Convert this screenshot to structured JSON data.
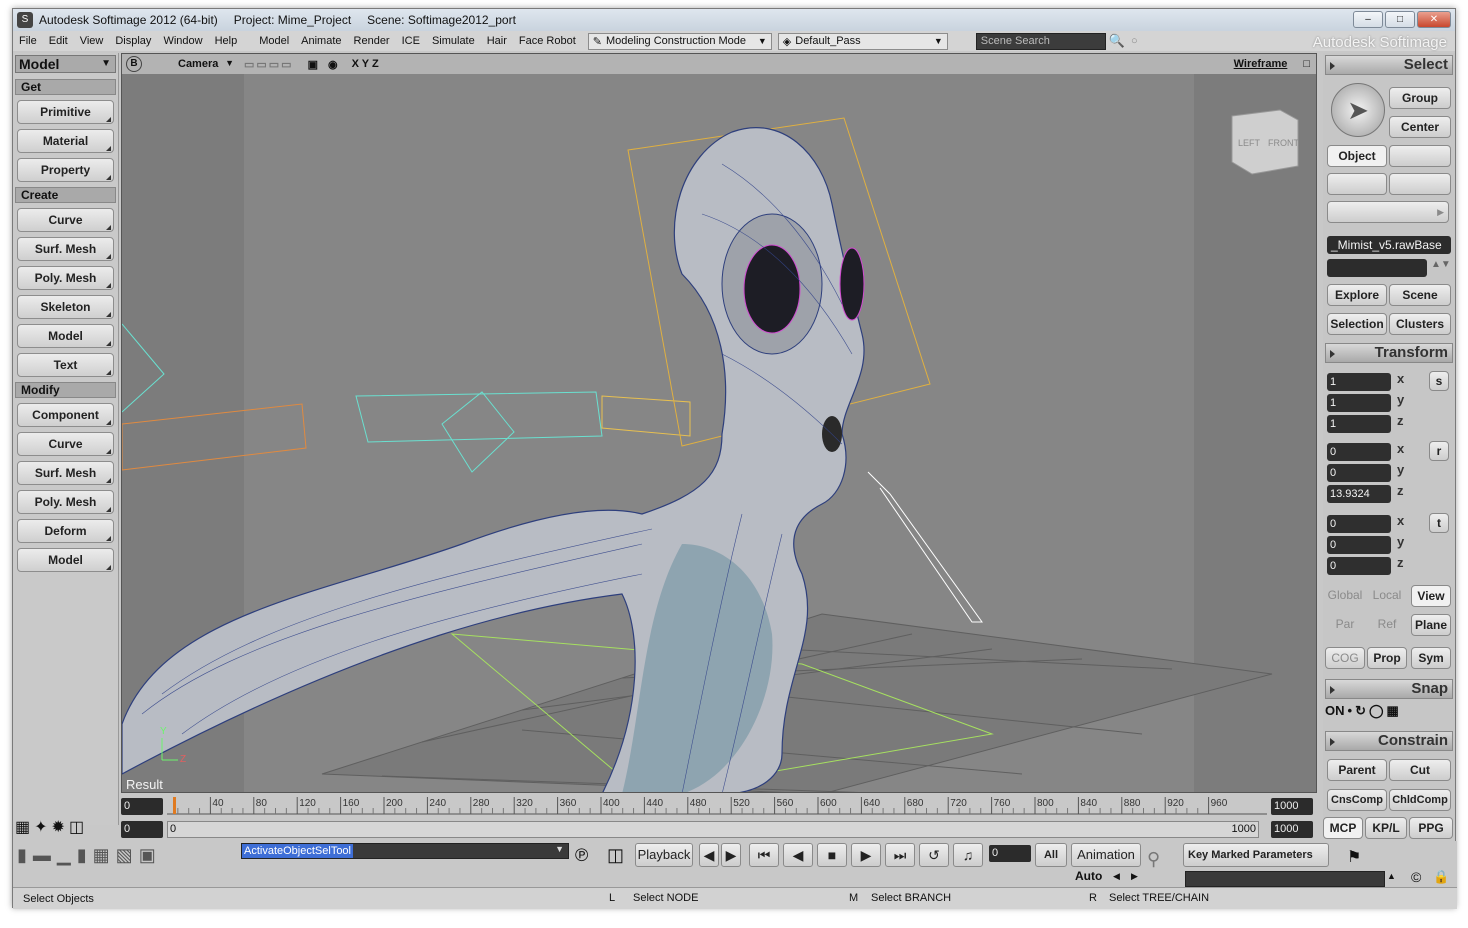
{
  "window": {
    "title": "Autodesk Softimage 2012 (64-bit)",
    "project": "Project: Mime_Project",
    "scene": "Scene: Softimage2012_port",
    "brand": "Autodesk Softimage"
  },
  "menu": [
    "File",
    "Edit",
    "View",
    "Display",
    "Window",
    "Help",
    "Model",
    "Animate",
    "Render",
    "ICE",
    "Simulate",
    "Hair",
    "Face Robot"
  ],
  "construction_mode": "Modeling Construction Mode",
  "render_pass": "Default_Pass",
  "search_placeholder": "Scene Search",
  "left_panel": {
    "module": "Model",
    "sections": [
      {
        "title": "Get",
        "buttons": [
          "Primitive",
          "Material",
          "Property"
        ]
      },
      {
        "title": "Create",
        "buttons": [
          "Curve",
          "Surf. Mesh",
          "Poly. Mesh",
          "Skeleton",
          "Model",
          "Text"
        ]
      },
      {
        "title": "Modify",
        "buttons": [
          "Component",
          "Curve",
          "Surf. Mesh",
          "Poly. Mesh",
          "Deform",
          "Model"
        ]
      }
    ]
  },
  "viewport": {
    "camera": "Camera",
    "axes": "X Y Z",
    "shading": "Wireframe",
    "label": "Result",
    "cube_left": "LEFT",
    "cube_front": "FRONT",
    "axis_y": "Y",
    "axis_z": "Z"
  },
  "right_panel": {
    "select_title": "Select",
    "group": "Group",
    "center": "Center",
    "object": "Object",
    "selection_name": "_Mimist_v5.rawBase",
    "explore": "Explore",
    "scene": "Scene",
    "selection": "Selection",
    "clusters": "Clusters",
    "transform_title": "Transform",
    "scale": [
      "1",
      "1",
      "1"
    ],
    "rotate": [
      "0",
      "0",
      "13.9324"
    ],
    "translate": [
      "0",
      "0",
      "0"
    ],
    "axis_labels": [
      "x",
      "y",
      "z"
    ],
    "srt": [
      "s",
      "r",
      "t"
    ],
    "ref_row1": [
      "Global",
      "Local",
      "View"
    ],
    "ref_row2": [
      "Par",
      "Ref",
      "Plane"
    ],
    "ref_row3": [
      "COG",
      "Prop",
      "Sym"
    ],
    "snap_title": "Snap",
    "snap_on": "ON",
    "constrain_title": "Constrain",
    "parent": "Parent",
    "cut": "Cut",
    "cnscomp": "CnsComp",
    "chldcomp": "ChldComp",
    "tabs": [
      "MCP",
      "KP/L",
      "PPG"
    ]
  },
  "timeline": {
    "start": "0",
    "end": "1000",
    "current": "0",
    "range_start": "0",
    "range_label_start": "0",
    "range_label_end": "1000",
    "range_end": "1000",
    "ticks": [
      "40",
      "80",
      "120",
      "160",
      "200",
      "240",
      "280",
      "320",
      "360",
      "400",
      "440",
      "480",
      "520",
      "560",
      "600",
      "640",
      "680",
      "720",
      "760",
      "800",
      "840",
      "880",
      "920",
      "960"
    ]
  },
  "bottom": {
    "command": "ActivateObjectSelTool",
    "playback": "Playback",
    "frame": "0",
    "all": "All",
    "animation": "Animation",
    "auto": "Auto",
    "key_marked": "Key Marked Parameters"
  },
  "status": {
    "message": "Select Objects",
    "l_label": "L",
    "l_text": "Select NODE",
    "m_label": "M",
    "m_text": "Select BRANCH",
    "r_label": "R",
    "r_text": "Select TREE/CHAIN"
  }
}
